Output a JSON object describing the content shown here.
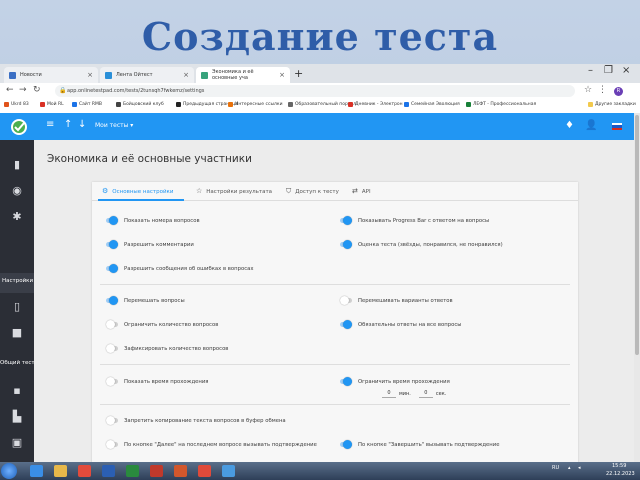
{
  "slide": {
    "title": "Создание теста"
  },
  "browser": {
    "tabs": [
      {
        "label": "Новости",
        "color": "#3b6fc4"
      },
      {
        "label": "Лента Ойтест",
        "color": "#2a8fd8"
      },
      {
        "label": "Экономика и её основные уча",
        "color": "#37a37c"
      }
    ],
    "new_tab": "+",
    "url": "app.onlinetestpad.com/tests/2tunsqh7fwkemz/settings",
    "profile_initial": "R",
    "bookmarks": [
      {
        "label": "Ukrd 83",
        "color": "#e0531b"
      },
      {
        "label": "Мой RL",
        "color": "#d93025"
      },
      {
        "label": "Сайт RMB",
        "color": "#1b73e8"
      },
      {
        "label": "Бойцовский клуб",
        "color": "#444444"
      },
      {
        "label": "Предыдущая страница",
        "color": "#222222"
      },
      {
        "label": "Интересные ссылки",
        "color": "#e8710a"
      },
      {
        "label": "Образовательный портал",
        "color": "#666666"
      },
      {
        "label": "Дневник - Электрон",
        "color": "#d93025"
      },
      {
        "label": "Семейная Эволюция",
        "color": "#1b73e8"
      },
      {
        "label": "ЛЕФТ - Профессиональная",
        "color": "#188038"
      },
      {
        "label": "Другие закладки",
        "color": "#f2c94c"
      }
    ]
  },
  "header": {
    "menu_label": "Мои тесты ▾"
  },
  "sidebar": {
    "items": [
      {
        "label": "Настройки"
      },
      {
        "label": "Общий тест..."
      }
    ]
  },
  "page": {
    "title": "Экономика и её основные участники"
  },
  "tabs": [
    {
      "label": "Основные настройки"
    },
    {
      "label": "Настройки результата"
    },
    {
      "label": "Доступ к тесту"
    },
    {
      "label": "API"
    }
  ],
  "options": {
    "show_question_numbers": {
      "label": "Показать номера вопросов",
      "on": true
    },
    "show_progress": {
      "label": "Показывать Progress Bar с ответом на вопросы",
      "on": true
    },
    "allow_comments": {
      "label": "Разрешить комментарии",
      "on": true
    },
    "rate_test": {
      "label": "Оценка теста (звёзды, понравился, не понравился)",
      "on": true
    },
    "allow_error_report": {
      "label": "Разрешить сообщения об ошибках в вопросах",
      "on": true
    },
    "shuffle_questions": {
      "label": "Перемешать вопросы",
      "on": true
    },
    "shuffle_answers": {
      "label": "Перемешивать варианты ответов",
      "on": false
    },
    "limit_questions": {
      "label": "Ограничить количество вопросов",
      "on": false
    },
    "require_all_answers": {
      "label": "Обязательны ответы на все вопросы",
      "on": true
    },
    "fixed_count": {
      "label": "Зафиксировать количество вопросов",
      "on": false
    },
    "show_time": {
      "label": "Показать время прохождения",
      "on": false
    },
    "limit_time": {
      "label": "Ограничить время прохождения",
      "on": true
    },
    "forbid_copy": {
      "label": "Запретить копирование текста вопросов в буфер обмена",
      "on": false
    },
    "next_confirm": {
      "label": "По кнопке \"Далее\" на последнем вопросе вызывать подтверждение",
      "on": false
    },
    "finish_confirm": {
      "label": "По кнопке \"Завершить\" вызывать подтверждение",
      "on": true
    }
  },
  "time_limit": {
    "minutes": "0",
    "minutes_unit": "мин.",
    "seconds": "0",
    "seconds_unit": "сек."
  },
  "taskbar": {
    "lang": "RU",
    "time": "15:59",
    "date": "22.12.2023",
    "apps": [
      {
        "name": "ie",
        "color": "#3a8ee6"
      },
      {
        "name": "explorer",
        "color": "#e7b84a"
      },
      {
        "name": "chrome",
        "color": "#e24b3c"
      },
      {
        "name": "word",
        "color": "#2b5fb3"
      },
      {
        "name": "excel",
        "color": "#2a8a3e"
      },
      {
        "name": "filezilla",
        "color": "#c0392b"
      },
      {
        "name": "powerpoint",
        "color": "#d2572c"
      },
      {
        "name": "yandex",
        "color": "#e04a3a"
      },
      {
        "name": "app",
        "color": "#4a9be0"
      }
    ]
  }
}
